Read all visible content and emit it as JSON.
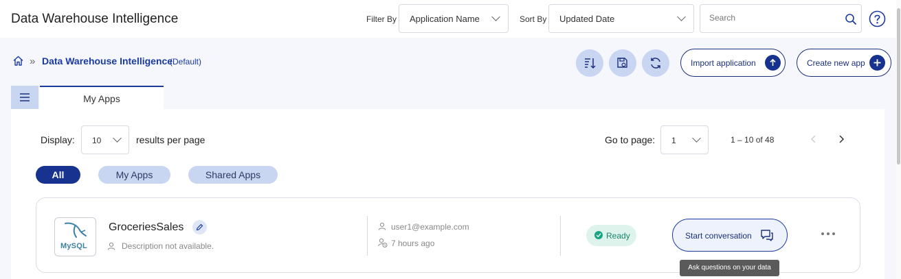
{
  "header": {
    "title": "Data Warehouse Intelligence",
    "filter_label": "Filter By",
    "filter_value": "Application Name",
    "sort_label": "Sort By",
    "sort_value": "Updated Date",
    "search_placeholder": "Search",
    "icons": [
      "search-icon",
      "help-icon"
    ]
  },
  "breadcrumb": {
    "home_icon": "home-icon",
    "separator": "»",
    "current": "Data Warehouse Intelligence",
    "suffix": "(Default)"
  },
  "toolbar": {
    "icon_buttons": [
      "sort-order-icon",
      "save-settings-icon",
      "refresh-icon"
    ],
    "import_label": "Import application",
    "create_label": "Create new app"
  },
  "tabs": {
    "menu_icon": "hamburger-icon",
    "active": "My Apps"
  },
  "pagination": {
    "display_label": "Display:",
    "per_page_value": "10",
    "per_page_suffix": "results per page",
    "goto_label": "Go to page:",
    "page_value": "1",
    "range_text": "1 – 10 of 48"
  },
  "filters": [
    {
      "label": "All",
      "active": true
    },
    {
      "label": "My Apps",
      "active": false
    },
    {
      "label": "Shared Apps",
      "active": false
    }
  ],
  "apps": [
    {
      "name": "GroceriesSales",
      "logo_text": "MySQL",
      "description": "Description not available.",
      "owner": "user1@example.com",
      "updated": "7 hours ago",
      "status": "Ready",
      "action_label": "Start conversation",
      "tooltip": "Ask questions on your data"
    }
  ],
  "colors": {
    "brand": "#17338f",
    "accent_light": "#c9d6f2",
    "ready_green": "#19a582",
    "page_bg": "#f5f7fc"
  }
}
